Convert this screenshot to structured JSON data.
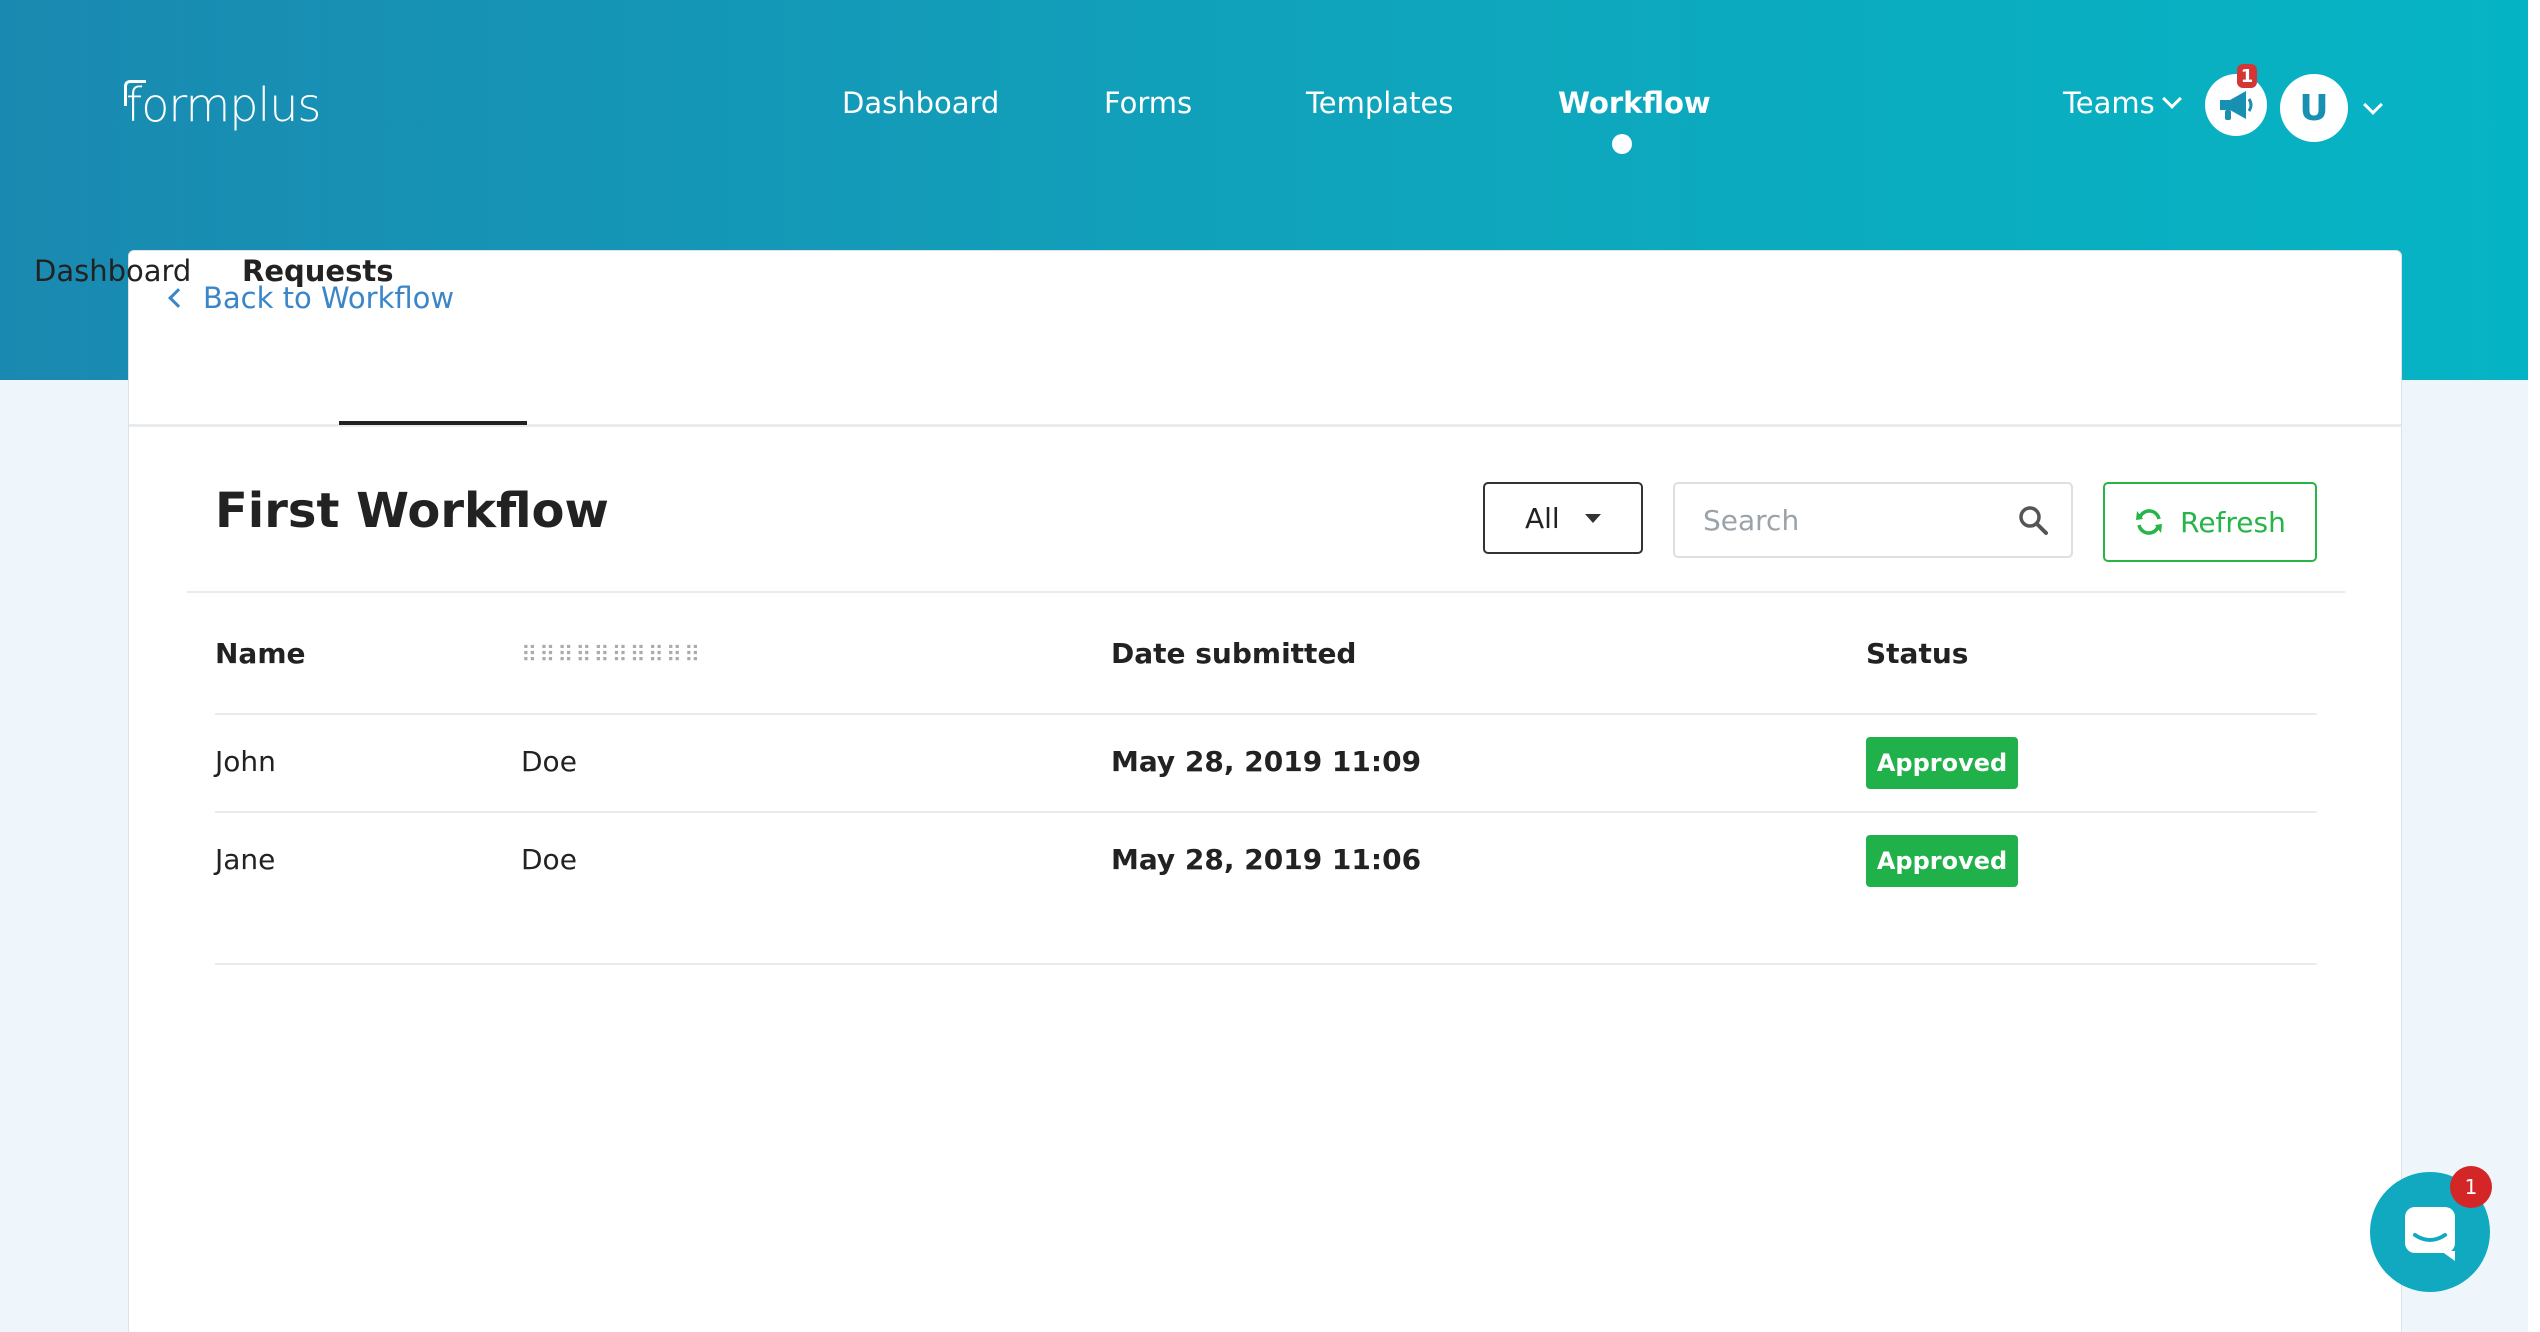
{
  "brand": {
    "logo_text": "formplus"
  },
  "topnav": {
    "items": [
      {
        "label": "Dashboard"
      },
      {
        "label": "Forms"
      },
      {
        "label": "Templates"
      },
      {
        "label": "Workflow",
        "active": true
      }
    ],
    "teams_label": "Teams",
    "announcements_badge": "1",
    "avatar_initial": "U"
  },
  "card": {
    "back_label": "Back to Workflow",
    "tabs": [
      {
        "label": "Dashboard"
      },
      {
        "label": "Requests",
        "active": true
      }
    ],
    "title": "First Workflow",
    "filter": {
      "selected": "All"
    },
    "search": {
      "placeholder": "Search",
      "value": ""
    },
    "refresh_label": "Refresh"
  },
  "table": {
    "headers": [
      "Name",
      "⠿⠿⠿⠿⠿⠿⠿⠿⠿⠿",
      "Date submitted",
      "Status"
    ],
    "rows": [
      {
        "first": "John",
        "last": "Doe",
        "date": "May 28, 2019 11:09",
        "status": "Approved"
      },
      {
        "first": "Jane",
        "last": "Doe",
        "date": "May 28, 2019 11:06",
        "status": "Approved"
      }
    ]
  },
  "chat": {
    "badge": "1"
  },
  "colors": {
    "header_gradient_start": "#1a89b1",
    "header_gradient_end": "#05b4c4",
    "link": "#3a86c8",
    "success": "#21b14a",
    "badge_red": "#d42626"
  }
}
